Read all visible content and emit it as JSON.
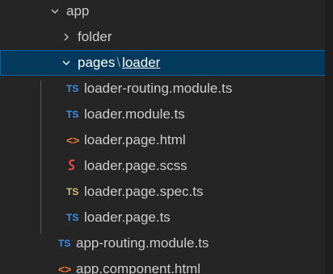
{
  "tree": {
    "app": {
      "label": "app"
    },
    "folder": {
      "label": "folder"
    },
    "pages": {
      "label_part1": "pages",
      "separator": "\\",
      "label_part2": "loader"
    },
    "children": [
      {
        "name": "loader-routing.module.ts",
        "icon": "TS"
      },
      {
        "name": "loader.module.ts",
        "icon": "TS"
      },
      {
        "name": "loader.page.html",
        "icon": "<>"
      },
      {
        "name": "loader.page.scss",
        "icon": "scss"
      },
      {
        "name": "loader.page.spec.ts",
        "icon": "TS"
      },
      {
        "name": "loader.page.ts",
        "icon": "TS"
      }
    ],
    "root_files": [
      {
        "name": "app-routing.module.ts",
        "icon": "TS"
      },
      {
        "name": "app.component.html",
        "icon": "<>"
      }
    ]
  },
  "colors": {
    "selection": "#04395e",
    "ts_blue": "#3b8eea",
    "spec_yellow": "#d7ba7d",
    "html_orange": "#e37933",
    "scss_red": "#f14c4c"
  }
}
